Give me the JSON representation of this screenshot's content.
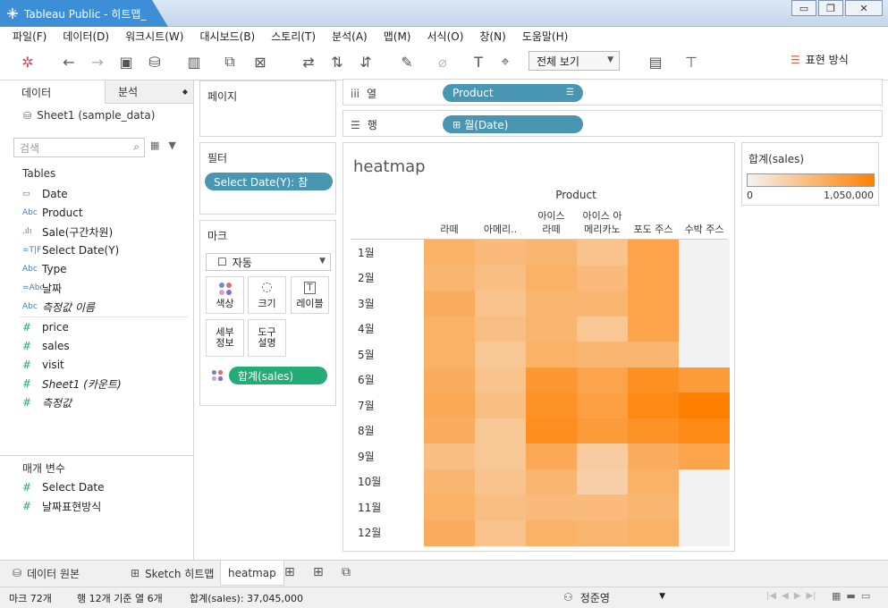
{
  "window": {
    "title": "Tableau Public - 히트맵_"
  },
  "menu": [
    "파일(F)",
    "데이터(D)",
    "워크시트(W)",
    "대시보드(B)",
    "스토리(T)",
    "분석(A)",
    "맵(M)",
    "서식(O)",
    "창(N)",
    "도움말(H)"
  ],
  "toolbar": {
    "view_select": "전체 보기",
    "show_me": "표현 방식"
  },
  "datapane": {
    "tab_data": "데이터",
    "tab_analysis": "분석",
    "source": "Sheet1 (sample_data)",
    "search_placeholder": "검색",
    "tables_label": "Tables",
    "dimensions": [
      {
        "icon": "calendar-icon",
        "type": "date",
        "label": "Date",
        "italic": false
      },
      {
        "icon": "abc-icon",
        "type": "Abc",
        "label": "Product",
        "italic": false
      },
      {
        "icon": "bin-icon",
        "type": ".ılı",
        "label": "Sale(구간차원)",
        "italic": false
      },
      {
        "icon": "calc-boolean-icon",
        "type": "=T|F",
        "label": "Select Date(Y)",
        "italic": false
      },
      {
        "icon": "abc-icon",
        "type": "Abc",
        "label": "Type",
        "italic": false
      },
      {
        "icon": "calc-abc-icon",
        "type": "=Abc",
        "label": "날짜",
        "italic": false
      },
      {
        "icon": "abc-icon",
        "type": "Abc",
        "label": "측정값 이름",
        "italic": true
      }
    ],
    "measures": [
      {
        "label": "price",
        "italic": false
      },
      {
        "label": "sales",
        "italic": false
      },
      {
        "label": "visit",
        "italic": false
      },
      {
        "label": "Sheet1 (카운트)",
        "italic": true
      },
      {
        "label": "측정값",
        "italic": true
      }
    ],
    "params_label": "매개 변수",
    "params": [
      "Select Date",
      "날짜표현방식"
    ]
  },
  "pages": {
    "title": "페이지"
  },
  "filters": {
    "title": "필터",
    "pill": "Select Date(Y): 참"
  },
  "marks": {
    "title": "마크",
    "type": "자동",
    "buttons": {
      "color": "색상",
      "size": "크기",
      "label": "레이블",
      "detail": "세부\n정보",
      "tooltip": "도구\n설명"
    },
    "pill": "합계(sales)"
  },
  "shelves": {
    "columns_label": "열",
    "columns_pill": "Product",
    "rows_label": "행",
    "rows_pill": "월(Date)"
  },
  "legend": {
    "title": "합계(sales)",
    "min": "0",
    "max": "1,050,000",
    "color_low": "#f3f3f3",
    "color_high": "#ff8000"
  },
  "chart_data": {
    "type": "heatmap",
    "title": "heatmap",
    "column_title": "Product",
    "columns": [
      "라떼",
      "아메리..",
      "아이스\n라떼",
      "아이스 아\n메리카노",
      "포도 주스",
      "수박 주스"
    ],
    "rows": [
      "1월",
      "2월",
      "3월",
      "4월",
      "5월",
      "6월",
      "7월",
      "8월",
      "9월",
      "10월",
      "11월",
      "12월"
    ],
    "value_range": [
      0,
      1050000
    ],
    "values": [
      [
        600000,
        520000,
        560000,
        440000,
        720000,
        null
      ],
      [
        560000,
        480000,
        600000,
        520000,
        720000,
        null
      ],
      [
        640000,
        440000,
        560000,
        560000,
        720000,
        null
      ],
      [
        600000,
        480000,
        560000,
        400000,
        720000,
        null
      ],
      [
        600000,
        400000,
        600000,
        560000,
        560000,
        null
      ],
      [
        640000,
        440000,
        840000,
        720000,
        900000,
        800000
      ],
      [
        680000,
        480000,
        880000,
        760000,
        960000,
        1050000
      ],
      [
        640000,
        400000,
        920000,
        800000,
        880000,
        960000
      ],
      [
        480000,
        400000,
        680000,
        360000,
        640000,
        720000
      ],
      [
        560000,
        440000,
        560000,
        320000,
        600000,
        null
      ],
      [
        600000,
        480000,
        520000,
        520000,
        560000,
        null
      ],
      [
        640000,
        440000,
        600000,
        560000,
        600000,
        null
      ]
    ]
  },
  "sheettabs": {
    "datasource": "데이터 원본",
    "sketch": "Sketch 히트맵",
    "heatmap": "heatmap"
  },
  "status": {
    "marks": "마크 72개",
    "rows_cols": "행 12개 기준 열 6개",
    "sum": "합계(sales): 37,045,000",
    "user": "정준영"
  }
}
